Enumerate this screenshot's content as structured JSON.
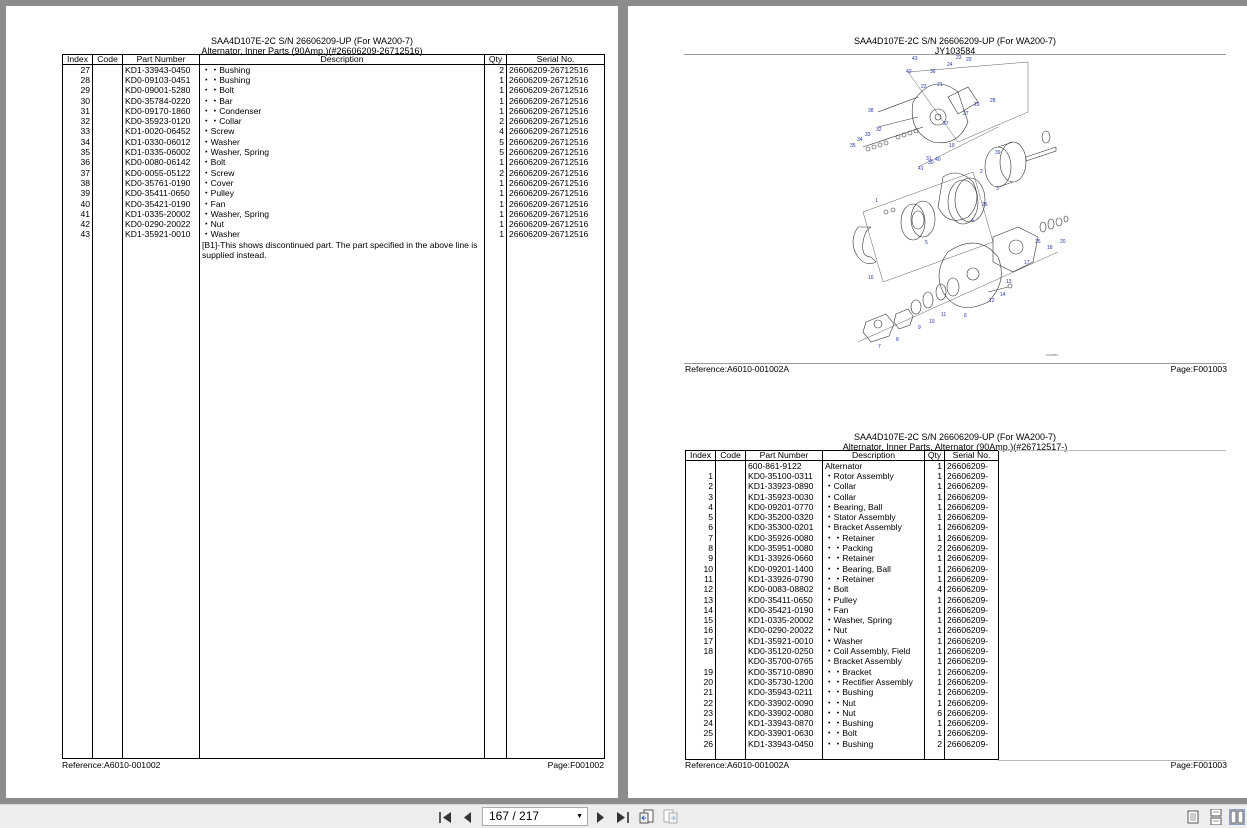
{
  "left_page": {
    "title_line1": "SAA4D107E-2C S/N 26606209-UP (For WA200-7)",
    "title_line2": "Alternator, Inner Parts (90Amp.)(#26606209-26712516)",
    "columns": [
      "Index",
      "Code",
      "Part Number",
      "Description",
      "Qty",
      "Serial No."
    ],
    "rows": [
      {
        "index": "27",
        "code": "",
        "part": "KD1-33943-0450",
        "desc": "・・Bushing",
        "qty": "2",
        "serial": "26606209-26712516"
      },
      {
        "index": "28",
        "code": "",
        "part": "KD0-09103-0451",
        "desc": "・・Bushing",
        "qty": "1",
        "serial": "26606209-26712516"
      },
      {
        "index": "29",
        "code": "",
        "part": "KD0-09001-5280",
        "desc": "・・Bolt",
        "qty": "1",
        "serial": "26606209-26712516"
      },
      {
        "index": "30",
        "code": "",
        "part": "KD0-35784-0220",
        "desc": "・・Bar",
        "qty": "1",
        "serial": "26606209-26712516"
      },
      {
        "index": "31",
        "code": "",
        "part": "KD0-09170-1860",
        "desc": "・・Condenser",
        "qty": "1",
        "serial": "26606209-26712516"
      },
      {
        "index": "32",
        "code": "",
        "part": "KD0-35923-0120",
        "desc": "・・Collar",
        "qty": "2",
        "serial": "26606209-26712516"
      },
      {
        "index": "33",
        "code": "",
        "part": "KD1-0020-06452",
        "desc": "・Screw",
        "qty": "4",
        "serial": "26606209-26712516"
      },
      {
        "index": "34",
        "code": "",
        "part": "KD1-0330-06012",
        "desc": "・Washer",
        "qty": "5",
        "serial": "26606209-26712516"
      },
      {
        "index": "35",
        "code": "",
        "part": "KD1-0335-06002",
        "desc": "・Washer, Spring",
        "qty": "5",
        "serial": "26606209-26712516"
      },
      {
        "index": "36",
        "code": "",
        "part": "KD0-0080-06142",
        "desc": "・Bolt",
        "qty": "1",
        "serial": "26606209-26712516"
      },
      {
        "index": "37",
        "code": "",
        "part": "KD0-0055-05122",
        "desc": "・Screw",
        "qty": "2",
        "serial": "26606209-26712516"
      },
      {
        "index": "38",
        "code": "",
        "part": "KD0-35761-0190",
        "desc": "・Cover",
        "qty": "1",
        "serial": "26606209-26712516"
      },
      {
        "index": "39",
        "code": "",
        "part": "KD0-35411-0650",
        "desc": "・Pulley",
        "qty": "1",
        "serial": "26606209-26712516"
      },
      {
        "index": "40",
        "code": "",
        "part": "KD0-35421-0190",
        "desc": "・Fan",
        "qty": "1",
        "serial": "26606209-26712516"
      },
      {
        "index": "41",
        "code": "",
        "part": "KD1-0335-20002",
        "desc": "・Washer, Spring",
        "qty": "1",
        "serial": "26606209-26712516"
      },
      {
        "index": "42",
        "code": "",
        "part": "KD0-0290-20022",
        "desc": "・Nut",
        "qty": "1",
        "serial": "26606209-26712516"
      },
      {
        "index": "43",
        "code": "",
        "part": "KD1-35921-0010",
        "desc": "・Washer",
        "qty": "1",
        "serial": "26606209-26712516"
      }
    ],
    "note": "[B1]-This shows discontinued part. The part specified in the above line is supplied instead.",
    "reference": "Reference:A6010-001002",
    "page_label": "Page:F001002"
  },
  "right_top": {
    "title_line1": "SAA4D107E-2C S/N 26606209-UP (For WA200-7)",
    "title_line2": "JY103584",
    "callouts": [
      "43",
      "23",
      "42",
      "36",
      "24",
      "20",
      "22",
      "21",
      "28",
      "38",
      "32",
      "29",
      "27",
      "37",
      "34",
      "33",
      "35",
      "19",
      "31",
      "40",
      "30",
      "41",
      "39",
      "2",
      "3",
      "1",
      "26",
      "4",
      "5",
      "16",
      "20",
      "18",
      "15",
      "17",
      "13",
      "14",
      "12",
      "6",
      "11",
      "10",
      "9",
      "8",
      "7"
    ],
    "reference": "Reference:A6010-001002A",
    "page_label": "Page:F001003"
  },
  "right_bottom": {
    "title_line1": "SAA4D107E-2C S/N 26606209-UP (For WA200-7)",
    "title_line2": "Alternator, Inner Parts, Alternator (90Amp.)(#26712517-)",
    "columns": [
      "Index",
      "Code",
      "Part Number",
      "Description",
      "Qty",
      "Serial No."
    ],
    "rows": [
      {
        "index": "",
        "code": "",
        "part": "600-861-9122",
        "desc": "Alternator",
        "qty": "1",
        "serial": "26606209-"
      },
      {
        "index": "1",
        "code": "",
        "part": "KD0-35100-0311",
        "desc": "・Rotor Assembly",
        "qty": "1",
        "serial": "26606209-"
      },
      {
        "index": "2",
        "code": "",
        "part": "KD1-33923-0890",
        "desc": "・Collar",
        "qty": "1",
        "serial": "26606209-"
      },
      {
        "index": "3",
        "code": "",
        "part": "KD1-35923-0030",
        "desc": "・Collar",
        "qty": "1",
        "serial": "26606209-"
      },
      {
        "index": "4",
        "code": "",
        "part": "KD0-09201-0770",
        "desc": "・Bearing, Ball",
        "qty": "1",
        "serial": "26606209-"
      },
      {
        "index": "5",
        "code": "",
        "part": "KD0-35200-0320",
        "desc": "・Stator Assembly",
        "qty": "1",
        "serial": "26606209-"
      },
      {
        "index": "6",
        "code": "",
        "part": "KD0-35300-0201",
        "desc": "・Bracket Assembly",
        "qty": "1",
        "serial": "26606209-"
      },
      {
        "index": "7",
        "code": "",
        "part": "KD0-35926-0080",
        "desc": "・・Retainer",
        "qty": "1",
        "serial": "26606209-"
      },
      {
        "index": "8",
        "code": "",
        "part": "KD0-35951-0080",
        "desc": "・・Packing",
        "qty": "2",
        "serial": "26606209-"
      },
      {
        "index": "9",
        "code": "",
        "part": "KD1-33926-0660",
        "desc": "・・Retainer",
        "qty": "1",
        "serial": "26606209-"
      },
      {
        "index": "10",
        "code": "",
        "part": "KD0-09201-1400",
        "desc": "・・Bearing, Ball",
        "qty": "1",
        "serial": "26606209-"
      },
      {
        "index": "11",
        "code": "",
        "part": "KD1-33926-0790",
        "desc": "・・Retainer",
        "qty": "1",
        "serial": "26606209-"
      },
      {
        "index": "12",
        "code": "",
        "part": "KD0-0083-08802",
        "desc": "・Bolt",
        "qty": "4",
        "serial": "26606209-"
      },
      {
        "index": "13",
        "code": "",
        "part": "KD0-35411-0650",
        "desc": "・Pulley",
        "qty": "1",
        "serial": "26606209-"
      },
      {
        "index": "14",
        "code": "",
        "part": "KD0-35421-0190",
        "desc": "・Fan",
        "qty": "1",
        "serial": "26606209-"
      },
      {
        "index": "15",
        "code": "",
        "part": "KD1-0335-20002",
        "desc": "・Washer, Spring",
        "qty": "1",
        "serial": "26606209-"
      },
      {
        "index": "16",
        "code": "",
        "part": "KD0-0290-20022",
        "desc": "・Nut",
        "qty": "1",
        "serial": "26606209-"
      },
      {
        "index": "17",
        "code": "",
        "part": "KD1-35921-0010",
        "desc": "・Washer",
        "qty": "1",
        "serial": "26606209-"
      },
      {
        "index": "18",
        "code": "",
        "part": "KD0-35120-0250",
        "desc": "・Coil Assembly, Field",
        "qty": "1",
        "serial": "26606209-"
      },
      {
        "index": "",
        "code": "",
        "part": "KD0-35700-0765",
        "desc": "・Bracket Assembly",
        "qty": "1",
        "serial": "26606209-"
      },
      {
        "index": "19",
        "code": "",
        "part": "KD0-35710-0890",
        "desc": "・・Bracket",
        "qty": "1",
        "serial": "26606209-"
      },
      {
        "index": "20",
        "code": "",
        "part": "KD0-35730-1200",
        "desc": "・・Rectifier Assembly",
        "qty": "1",
        "serial": "26606209-"
      },
      {
        "index": "21",
        "code": "",
        "part": "KD0-35943-0211",
        "desc": "・・Bushing",
        "qty": "1",
        "serial": "26606209-"
      },
      {
        "index": "22",
        "code": "",
        "part": "KD0-33902-0090",
        "desc": "・・Nut",
        "qty": "1",
        "serial": "26606209-"
      },
      {
        "index": "23",
        "code": "",
        "part": "KD0-33902-0080",
        "desc": "・・Nut",
        "qty": "6",
        "serial": "26606209-"
      },
      {
        "index": "24",
        "code": "",
        "part": "KD1-33943-0870",
        "desc": "・・Bushing",
        "qty": "1",
        "serial": "26606209-"
      },
      {
        "index": "25",
        "code": "",
        "part": "KD0-33901-0630",
        "desc": "・・Bolt",
        "qty": "1",
        "serial": "26606209-"
      },
      {
        "index": "26",
        "code": "",
        "part": "KD1-33943-0450",
        "desc": "・・Bushing",
        "qty": "2",
        "serial": "26606209-"
      }
    ],
    "reference": "Reference:A6010-001002A",
    "page_label": "Page:F001003"
  },
  "viewer_toolbar": {
    "page_indicator": "167 / 217",
    "buttons": [
      "first-page-icon",
      "prev-page-icon",
      "next-page-icon",
      "last-page-icon",
      "go-back-view-icon",
      "go-forward-view-icon",
      "single-page-view-icon",
      "continuous-view-icon",
      "two-page-view-icon"
    ]
  }
}
